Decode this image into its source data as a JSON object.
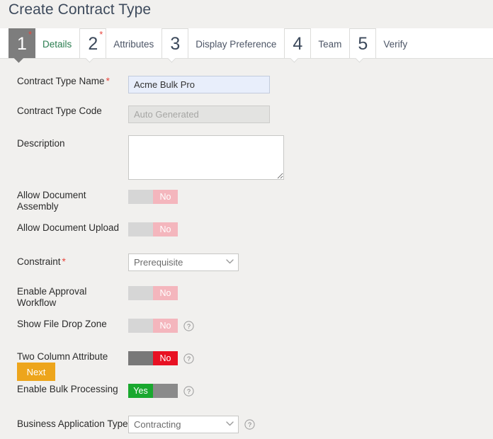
{
  "page": {
    "title": "Create Contract Type"
  },
  "wizard": {
    "steps": [
      {
        "number": "1",
        "label": "Details",
        "required": true,
        "active": true
      },
      {
        "number": "2",
        "label": "Attributes",
        "required": true,
        "active": false
      },
      {
        "number": "3",
        "label": "Display Preference",
        "required": false,
        "active": false
      },
      {
        "number": "4",
        "label": "Team",
        "required": false,
        "active": false
      },
      {
        "number": "5",
        "label": "Verify",
        "required": false,
        "active": false
      }
    ],
    "required_marker": "*"
  },
  "form": {
    "contract_type_name": {
      "label": "Contract Type Name",
      "required_marker": "*",
      "value": "Acme Bulk Pro",
      "placeholder": ""
    },
    "contract_type_code": {
      "label": "Contract Type Code",
      "value": "",
      "placeholder": "Auto Generated"
    },
    "description": {
      "label": "Description",
      "value": "",
      "placeholder": ""
    },
    "allow_document_assembly": {
      "label": "Allow Document Assembly",
      "state": "No"
    },
    "allow_document_upload": {
      "label": "Allow Document Upload",
      "state": "No"
    },
    "constraint": {
      "label": "Constraint",
      "required_marker": "*",
      "value": "Prerequisite",
      "options": [
        "Prerequisite"
      ]
    },
    "enable_approval_workflow": {
      "label": "Enable Approval Workflow",
      "state": "No"
    },
    "show_file_drop_zone": {
      "label": "Show File Drop Zone",
      "state": "No",
      "help": "?"
    },
    "two_column_attribute_layout": {
      "label": "Two Column Attribute Layout",
      "state": "No",
      "help": "?"
    },
    "enable_bulk_processing": {
      "label": "Enable Bulk Processing",
      "state": "Yes",
      "help": "?"
    },
    "business_application_type": {
      "label": "Business Application Type",
      "value": "Contracting",
      "options": [
        "Contracting"
      ],
      "help": "?"
    }
  },
  "actions": {
    "next_label": "Next"
  },
  "colors": {
    "accent_orange": "#eda51c",
    "active_step_green": "#2a7d4f",
    "required_red": "#e8453c",
    "toggle_on_green": "#19a82e",
    "toggle_on_red": "#e81123",
    "toggle_pale_pink": "#f4b6bd",
    "page_background": "#f1f0ee"
  },
  "icons": {
    "help": "help-circle-icon",
    "chevron": "chevron-down-icon"
  }
}
